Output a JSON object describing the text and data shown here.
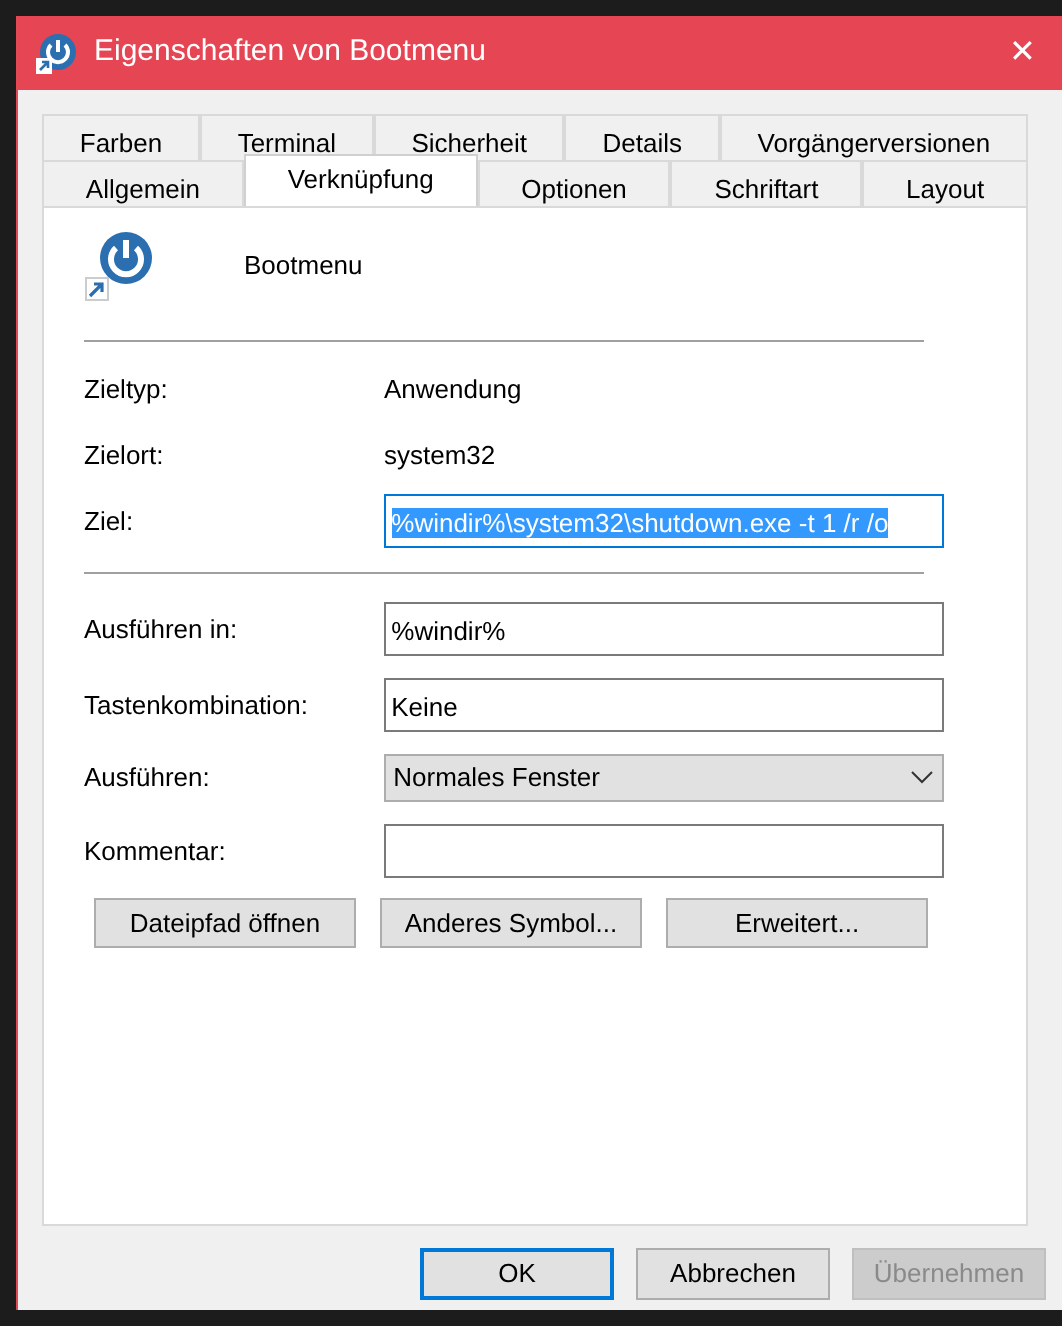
{
  "window": {
    "title": "Eigenschaften von Bootmenu",
    "close": "✕"
  },
  "tab_rows": [
    [
      {
        "label": "Farben",
        "selected": false
      },
      {
        "label": "Terminal",
        "selected": false
      },
      {
        "label": "Sicherheit",
        "selected": false
      },
      {
        "label": "Details",
        "selected": false
      },
      {
        "label": "Vorgängerversionen",
        "selected": false
      }
    ],
    [
      {
        "label": "Allgemein",
        "selected": false
      },
      {
        "label": "Verknüpfung",
        "selected": true
      },
      {
        "label": "Optionen",
        "selected": false
      },
      {
        "label": "Schriftart",
        "selected": false
      },
      {
        "label": "Layout",
        "selected": false
      }
    ]
  ],
  "shortcut": {
    "name": "Bootmenu"
  },
  "info": [
    {
      "label": "Zieltyp:",
      "value": "Anwendung"
    },
    {
      "label": "Zielort:",
      "value": "system32"
    }
  ],
  "target": {
    "label": "Ziel:",
    "value": "%windir%\\system32\\shutdown.exe -t 1 /r /o",
    "selected": true
  },
  "fields": [
    {
      "kind": "text",
      "label": "Ausführen in:",
      "value": "%windir%"
    },
    {
      "kind": "text",
      "label": "Tastenkombination:",
      "value": "Keine"
    },
    {
      "kind": "select",
      "label": "Ausführen:",
      "value": "Normales Fenster"
    },
    {
      "kind": "text",
      "label": "Kommentar:"
    }
  ],
  "actions": [
    "Dateipfad öffnen",
    "Anderes Symbol...",
    "Erweitert..."
  ],
  "buttons": [
    {
      "label": "OK",
      "default": true,
      "disabled": false
    },
    {
      "label": "Abbrechen",
      "default": false,
      "disabled": false
    },
    {
      "label": "Übernehmen",
      "default": false,
      "disabled": true
    }
  ]
}
